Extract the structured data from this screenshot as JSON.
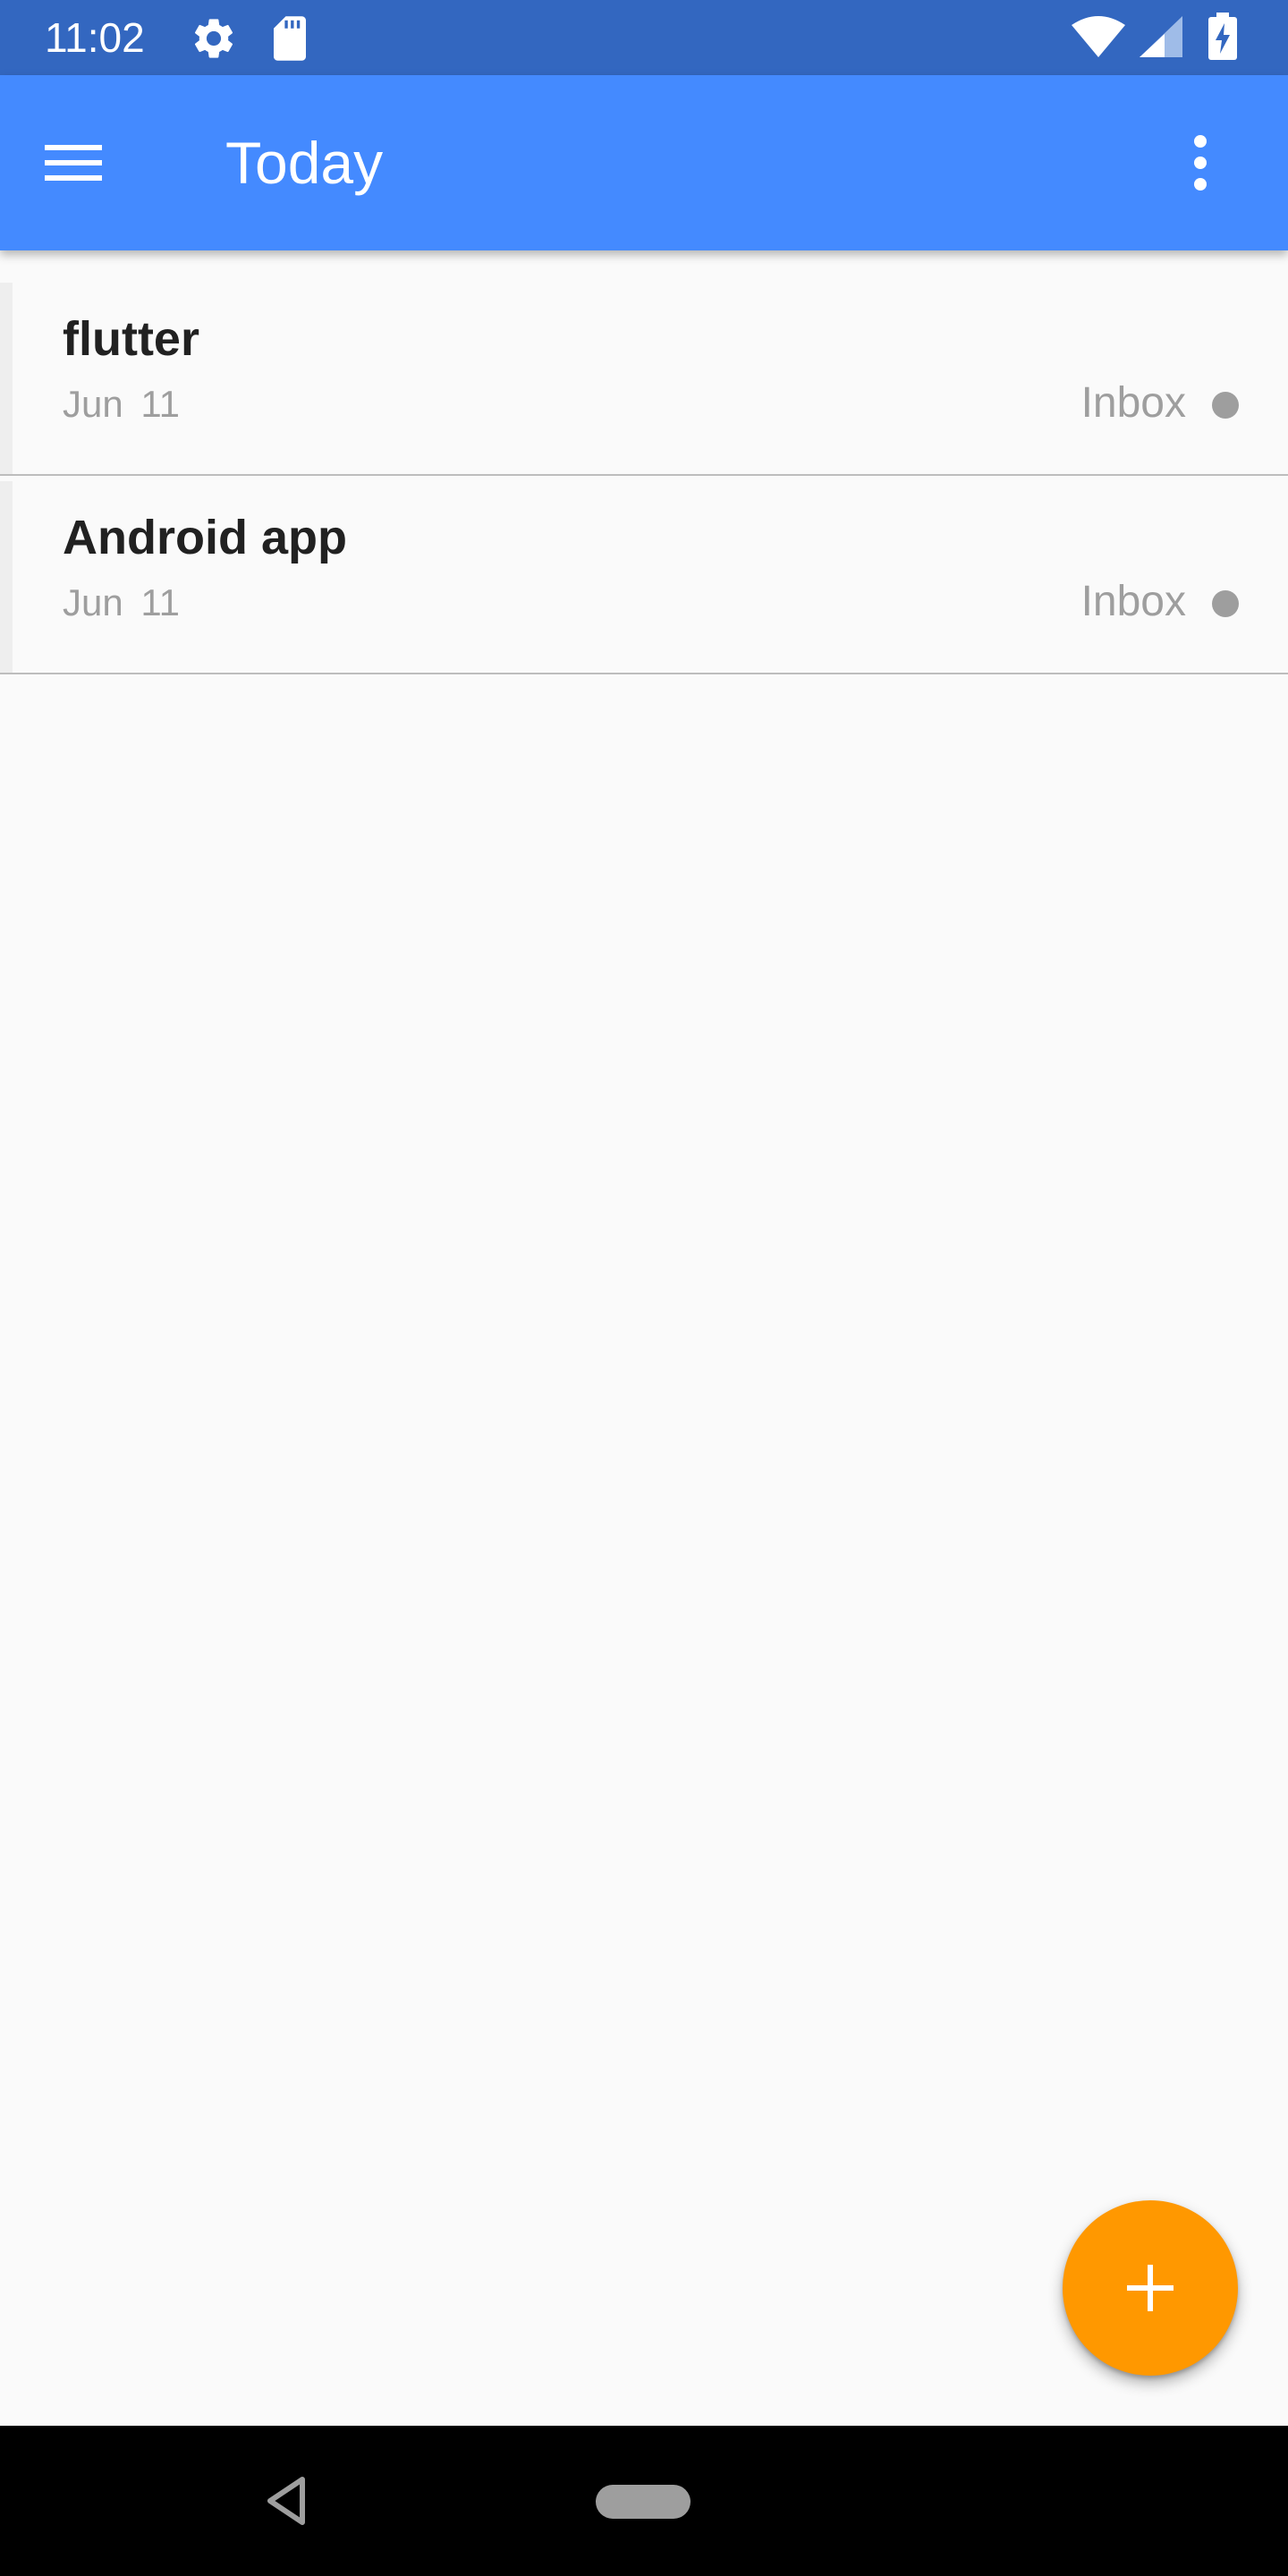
{
  "status_bar": {
    "time": "11:02",
    "icons": [
      "settings-icon",
      "sd-card-icon",
      "wifi-icon",
      "signal-icon",
      "battery-charging-icon"
    ]
  },
  "app_bar": {
    "title": "Today",
    "left_icon": "menu-icon",
    "right_icon": "more-vert-icon",
    "color": "#448AFF"
  },
  "tasks": [
    {
      "title": "flutter",
      "date": "Jun  11",
      "project": "Inbox",
      "project_color": "#9E9E9E"
    },
    {
      "title": "Android app",
      "date": "Jun  11",
      "project": "Inbox",
      "project_color": "#9E9E9E"
    }
  ],
  "fab": {
    "icon": "add-icon",
    "color": "#FF9800"
  },
  "nav_bar": {
    "icons": [
      "back-icon",
      "home-icon"
    ]
  }
}
